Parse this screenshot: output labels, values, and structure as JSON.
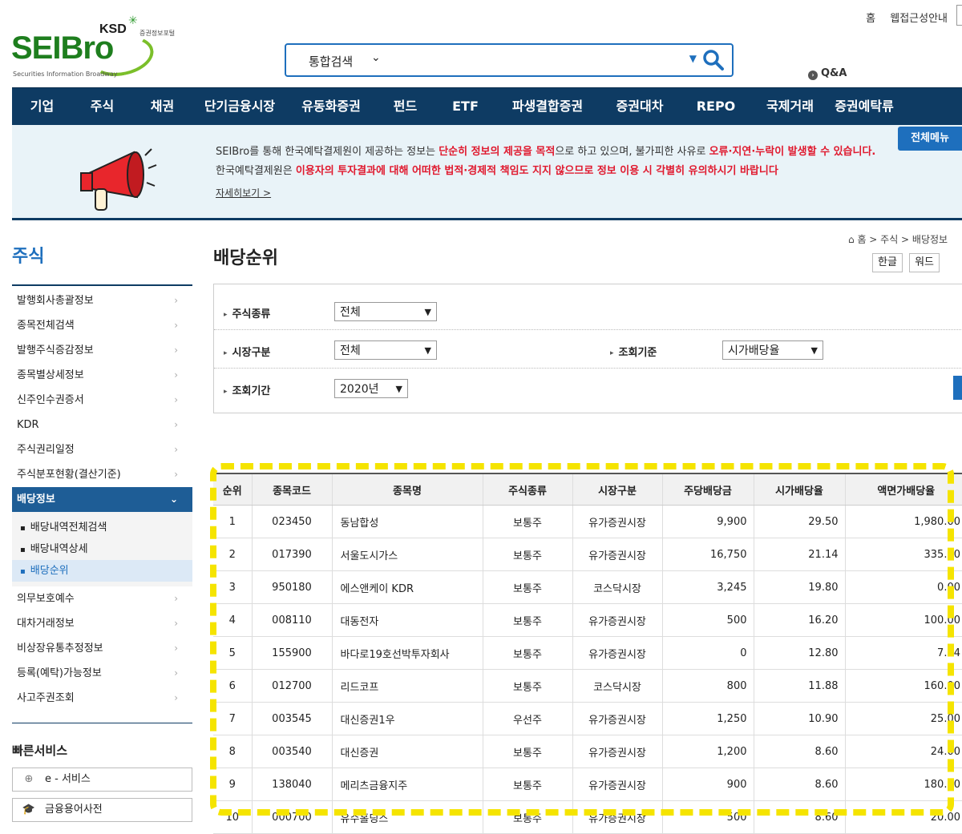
{
  "top_links": [
    "홈",
    "웹접근성안내"
  ],
  "logo": {
    "ksd": "KSD",
    "ksd_sub": "증권정보포털",
    "main": "SEIBro",
    "tagline": "Securities Information Broadway"
  },
  "search": {
    "scope": "통합검색",
    "value": ""
  },
  "qa_link": "Q&A",
  "nav": [
    "기업",
    "주식",
    "채권",
    "단기금융시장",
    "유동화증권",
    "펀드",
    "ETF",
    "파생결합증권",
    "증권대차",
    "REPO",
    "국제거래",
    "증권예탁류"
  ],
  "notice": {
    "line1_a": "SEIBro를 통해 한국예탁결제원이 제공하는 정보는 ",
    "line1_b": "단순히 정보의 제공을 목적",
    "line1_c": "으로 하고 있으며, 불가피한 사유로 ",
    "line1_d": "오류·지연·누락이 발생할 수 있습니다.",
    "line2_a": "한국예탁결제원은 ",
    "line2_b": "이용자의 투자결과에 대해 어떠한 법적·경제적 책임도 지지 않으므로 정보 이용 시 각별히 유의하시기 바랍니다",
    "more": "자세히보기  >",
    "full_menu": "전체메뉴"
  },
  "sidebar": {
    "title": "주식",
    "items_top": [
      "발행회사총괄정보",
      "종목전체검색",
      "발행주식증감정보",
      "종목별상세정보",
      "신주인수권증서",
      "KDR",
      "주식권리일정",
      "주식분포현황(결산기준)"
    ],
    "active": "배당정보",
    "sub": [
      "배당내역전체검색",
      "배당내역상세",
      "배당순위"
    ],
    "items_bottom": [
      "의무보호예수",
      "대차거래정보",
      "비상장유통추정정보",
      "등록(예탁)가능정보",
      "사고주권조회"
    ],
    "quick_title": "빠른서비스",
    "quick": [
      "e - 서비스",
      "금융용어사전"
    ]
  },
  "page": {
    "title": "배당순위",
    "breadcrumb": "홈 > 주식 > 배당정보",
    "downloads": [
      "한글",
      "워드"
    ]
  },
  "filters": {
    "stock_type": {
      "label": "주식종류",
      "value": "전체"
    },
    "market": {
      "label": "시장구분",
      "value": "전체"
    },
    "criteria": {
      "label": "조회기준",
      "value": "시가배당율"
    },
    "period": {
      "label": "조회기간",
      "value": "2020년"
    }
  },
  "table": {
    "headers": [
      "순위",
      "종목코드",
      "종목명",
      "주식종류",
      "시장구분",
      "주당배당금",
      "시가배당율",
      "액면가배당율"
    ],
    "rows": [
      [
        "1",
        "023450",
        "동남합성",
        "보통주",
        "유가증권시장",
        "9,900",
        "29.50",
        "1,980.00"
      ],
      [
        "2",
        "017390",
        "서울도시가스",
        "보통주",
        "유가증권시장",
        "16,750",
        "21.14",
        "335.00"
      ],
      [
        "3",
        "950180",
        "에스앤케이 KDR",
        "보통주",
        "코스닥시장",
        "3,245",
        "19.80",
        "0.00"
      ],
      [
        "4",
        "008110",
        "대동전자",
        "보통주",
        "유가증권시장",
        "500",
        "16.20",
        "100.00"
      ],
      [
        "5",
        "155900",
        "바다로19호선박투자회사",
        "보통주",
        "유가증권시장",
        "0",
        "12.80",
        "7.04"
      ],
      [
        "6",
        "012700",
        "리드코프",
        "보통주",
        "코스닥시장",
        "800",
        "11.88",
        "160.00"
      ],
      [
        "7",
        "003545",
        "대신증권1우",
        "우선주",
        "유가증권시장",
        "1,250",
        "10.90",
        "25.00"
      ],
      [
        "8",
        "003540",
        "대신증권",
        "보통주",
        "유가증권시장",
        "1,200",
        "8.60",
        "24.00"
      ],
      [
        "9",
        "138040",
        "메리츠금융지주",
        "보통주",
        "유가증권시장",
        "900",
        "8.60",
        "180.00"
      ],
      [
        "10",
        "000700",
        "유수홀딩스",
        "보통주",
        "유가증권시장",
        "500",
        "8.60",
        "20.00"
      ]
    ]
  },
  "colors": {
    "nav_bg": "#0e3b63",
    "accent": "#1e6fbd",
    "warning_red": "#e0192e",
    "highlight": "#f5e400"
  }
}
